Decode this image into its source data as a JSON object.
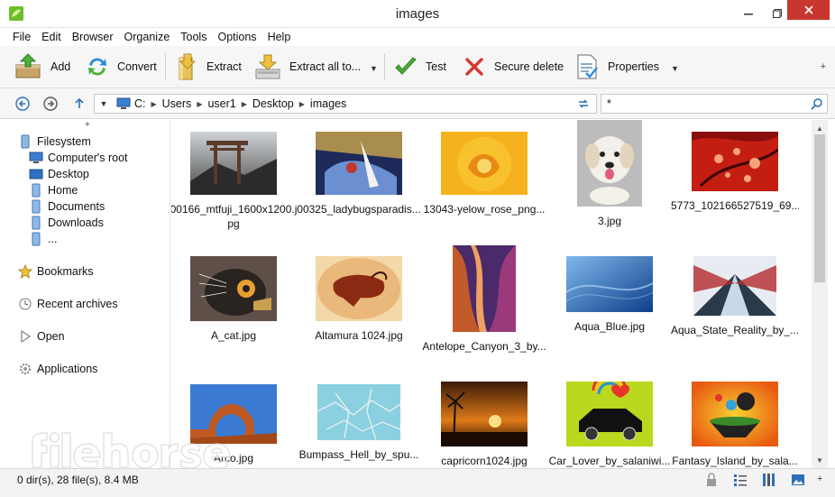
{
  "window": {
    "title": "images"
  },
  "menu": [
    "File",
    "Edit",
    "Browser",
    "Organize",
    "Tools",
    "Options",
    "Help"
  ],
  "toolbar": {
    "add": "Add",
    "convert": "Convert",
    "extract": "Extract",
    "extract_all": "Extract all to...",
    "test": "Test",
    "secure_delete": "Secure delete",
    "properties": "Properties"
  },
  "address": {
    "crumbs": [
      "C:",
      "Users",
      "user1",
      "Desktop",
      "images"
    ],
    "filter_value": "*"
  },
  "sidebar": {
    "filesystem": "Filesystem",
    "children": [
      "Computer's root",
      "Desktop",
      "Home",
      "Documents",
      "Downloads",
      "..."
    ],
    "bookmarks": "Bookmarks",
    "recent": "Recent archives",
    "open": "Open",
    "applications": "Applications"
  },
  "files": [
    {
      "name": "00166_mtfuji_1600x1200.jpg",
      "line1": "00166_mtfuji_1600x1200.j",
      "line2": "pg"
    },
    {
      "name": "00325_ladybugsparadis...",
      "line1": "00325_ladybugsparadis...",
      "line2": ""
    },
    {
      "name": "13043-yelow_rose_png...",
      "line1": "13043-yelow_rose_png...",
      "line2": ""
    },
    {
      "name": "3.jpg",
      "line1": "3.jpg",
      "line2": ""
    },
    {
      "name": "5773_102166527519_69...",
      "line1": "5773_102166527519_69...",
      "line2": ""
    },
    {
      "name": "A_cat.jpg",
      "line1": "A_cat.jpg",
      "line2": ""
    },
    {
      "name": "Altamura 1024.jpg",
      "line1": "Altamura 1024.jpg",
      "line2": ""
    },
    {
      "name": "Antelope_Canyon_3_by...",
      "line1": "Antelope_Canyon_3_by...",
      "line2": ""
    },
    {
      "name": "Aqua_Blue.jpg",
      "line1": "Aqua_Blue.jpg",
      "line2": ""
    },
    {
      "name": "Aqua_State_Reality_by_...",
      "line1": "Aqua_State_Reality_by_...",
      "line2": ""
    },
    {
      "name": "Arco.jpg",
      "line1": "Arco.jpg",
      "line2": ""
    },
    {
      "name": "Bumpass_Hell_by_spu...",
      "line1": "Bumpass_Hell_by_spu...",
      "line2": ""
    },
    {
      "name": "capricorn1024.jpg",
      "line1": "capricorn1024.jpg",
      "line2": ""
    },
    {
      "name": "Car_Lover_by_salaniwi...",
      "line1": "Car_Lover_by_salaniwi...",
      "line2": ""
    },
    {
      "name": "Fantasy_Island_by_sala...",
      "line1": "Fantasy_Island_by_sala...",
      "line2": ""
    }
  ],
  "status": {
    "text": "0 dir(s), 28 file(s), 8.4 MB"
  },
  "colors": {
    "close": "#c7372f",
    "accent": "#2a7fd4",
    "folder": "#8fb9e4"
  }
}
